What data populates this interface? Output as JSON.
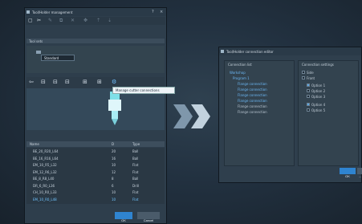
{
  "left_dialog": {
    "title": "Tool/Holder management",
    "window_controls": [
      "?",
      "×"
    ],
    "toolbar": {
      "items": [
        {
          "icon": "new-document-icon",
          "glyph": "▢"
        },
        {
          "icon": "cut-icon",
          "glyph": "✂"
        },
        {
          "icon": "edit-icon",
          "glyph": "✎"
        },
        {
          "icon": "copy-icon",
          "glyph": "⧉"
        },
        {
          "icon": "delete-icon",
          "glyph": "✕"
        },
        {
          "icon": "move-icon",
          "glyph": "✥"
        },
        {
          "icon": "up-icon",
          "glyph": "⇡"
        },
        {
          "icon": "down-icon",
          "glyph": "⇣"
        }
      ]
    },
    "group_label": "Tool sets",
    "tree": {
      "node_a": "Tool sets",
      "node_b": "Standard"
    },
    "view_toolbar": {
      "items": [
        {
          "icon": "back-icon",
          "glyph": "⇦"
        },
        {
          "icon": "tool-icon-1",
          "glyph": "⊟"
        },
        {
          "icon": "tool-icon-2",
          "glyph": "⊟"
        },
        {
          "icon": "tool-icon-3",
          "glyph": "⊟"
        },
        {
          "icon": "holder-icon-1",
          "glyph": "⊞"
        },
        {
          "icon": "holder-icon-2",
          "glyph": "⊞"
        },
        {
          "icon": "manage-cutter-connections-icon",
          "glyph": "⚙"
        }
      ]
    },
    "tooltip": "Manage cutter connections",
    "table": {
      "headers": [
        "Name",
        "D",
        "Type"
      ],
      "rows": [
        {
          "name": "BE_20_R20_L64",
          "d": "20",
          "type": "Ball",
          "selected": false
        },
        {
          "name": "BE_16_R16_L64",
          "d": "16",
          "type": "Ball",
          "selected": false
        },
        {
          "name": "EM_10_R5_L32",
          "d": "10",
          "type": "Flat",
          "selected": false
        },
        {
          "name": "EM_12_R6_L32",
          "d": "12",
          "type": "Flat",
          "selected": false
        },
        {
          "name": "BE_8_R8_L40",
          "d": "8",
          "type": "Ball",
          "selected": false
        },
        {
          "name": "DR_6_R0_L36",
          "d": "6",
          "type": "Drill",
          "selected": false
        },
        {
          "name": "CH_10_R0_L33",
          "d": "10",
          "type": "Flat",
          "selected": false
        },
        {
          "name": "EM_10_R0_L48",
          "d": "10",
          "type": "Flat",
          "selected": true
        }
      ]
    },
    "ok_label": "OK",
    "cancel_label": "Cancel"
  },
  "right_dialog": {
    "title": "Tool/Holder connection editor",
    "left_panel_title": "Connection list",
    "tree": [
      {
        "text": "Workshop",
        "kind": "link"
      },
      {
        "text": "Program 1",
        "kind": "link"
      },
      {
        "text": "Flange connection",
        "kind": "link"
      },
      {
        "text": "Flange connection",
        "kind": "link"
      },
      {
        "text": "Flange connection",
        "kind": "link"
      },
      {
        "text": "Flange connection",
        "kind": "link"
      },
      {
        "text": "Flange connection",
        "kind": "plain"
      },
      {
        "text": "Flange connection",
        "kind": "plain"
      }
    ],
    "right_panel_title": "Connection settings",
    "options": [
      {
        "text": "Side",
        "checked": false
      },
      {
        "text": "Front",
        "checked": false
      },
      {
        "text": "Option 1",
        "checked": true
      },
      {
        "text": "Option 2",
        "checked": false
      },
      {
        "text": "Option 3",
        "checked": false
      },
      {
        "text": "Option 4",
        "checked": true
      },
      {
        "text": "Option 5",
        "checked": false
      }
    ],
    "ok_label": "OK",
    "cancel_label": "…"
  },
  "colors": {
    "accent": "#2f84d0",
    "link": "#6cb8f5",
    "window_bg": "#2e3e4c"
  }
}
